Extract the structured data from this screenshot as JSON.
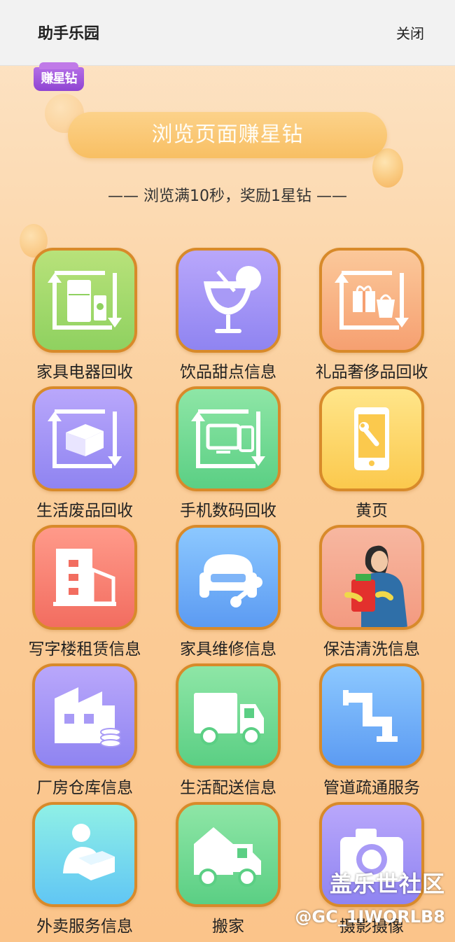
{
  "header": {
    "title": "助手乐园",
    "close_label": "关闭"
  },
  "badge": {
    "label": "赚星钻"
  },
  "banner": {
    "button_label": "浏览页面赚星钻",
    "subtitle": "—— 浏览满10秒，奖励1星钻 ——"
  },
  "grid": [
    {
      "label": "家具电器回收",
      "icon": "appliance-recycle-icon",
      "color": "green"
    },
    {
      "label": "饮品甜点信息",
      "icon": "drink-icon",
      "color": "purple"
    },
    {
      "label": "礼品奢侈品回收",
      "icon": "gift-recycle-icon",
      "color": "orange"
    },
    {
      "label": "生活废品回收",
      "icon": "waste-recycle-icon",
      "color": "purple"
    },
    {
      "label": "手机数码回收",
      "icon": "digital-recycle-icon",
      "color": "mint"
    },
    {
      "label": "黄页",
      "icon": "phone-wrench-icon",
      "color": "yellow"
    },
    {
      "label": "写字楼租赁信息",
      "icon": "office-building-icon",
      "color": "red"
    },
    {
      "label": "家具维修信息",
      "icon": "sofa-wrench-icon",
      "color": "blue"
    },
    {
      "label": "保洁清洗信息",
      "icon": "cleaner-icon",
      "color": "salmon"
    },
    {
      "label": "厂房仓库信息",
      "icon": "factory-icon",
      "color": "purple"
    },
    {
      "label": "生活配送信息",
      "icon": "delivery-truck-icon",
      "color": "mint"
    },
    {
      "label": "管道疏通服务",
      "icon": "pipe-icon",
      "color": "blue"
    },
    {
      "label": "外卖服务信息",
      "icon": "courier-icon",
      "color": "cyan"
    },
    {
      "label": "搬家",
      "icon": "moving-truck-icon",
      "color": "mint"
    },
    {
      "label": "摄影摄像",
      "icon": "camera-icon",
      "color": "purple"
    }
  ],
  "watermark": {
    "line1": "盖乐世社区",
    "line2": "@GC_1IWORLB8"
  }
}
